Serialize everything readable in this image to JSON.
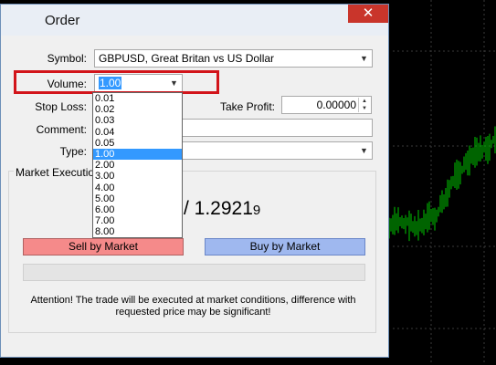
{
  "dialog": {
    "title": "Order",
    "close_glyph": "✕",
    "symbol": {
      "label": "Symbol:",
      "value": "GBPUSD, Great Britan vs US Dollar"
    },
    "volume": {
      "label": "Volume:",
      "value": "1.00"
    },
    "stop_loss": {
      "label": "Stop Loss:"
    },
    "take_profit": {
      "label": "Take Profit:",
      "value": "0.00000"
    },
    "comment": {
      "label": "Comment:"
    },
    "type": {
      "label": "Type:"
    },
    "market_execution": {
      "title": "Market Execution",
      "price_main": "/ 1.2921",
      "price_small": "9",
      "sell_label": "Sell by Market",
      "buy_label": "Buy by Market",
      "attention_line1": "Attention! The trade will be executed at market conditions, difference with",
      "attention_line2": "requested price may be significant!"
    },
    "volume_options": [
      "0.01",
      "0.02",
      "0.03",
      "0.04",
      "0.05",
      "1.00",
      "2.00",
      "3.00",
      "4.00",
      "5.00",
      "6.00",
      "7.00",
      "8.00"
    ],
    "volume_selected_index": 5
  },
  "colors": {
    "sell": "#f58a8a",
    "buy": "#9fb8ef",
    "highlight": "#d2141a",
    "chart_candle": "#00c800",
    "close_button": "#c9352b"
  }
}
